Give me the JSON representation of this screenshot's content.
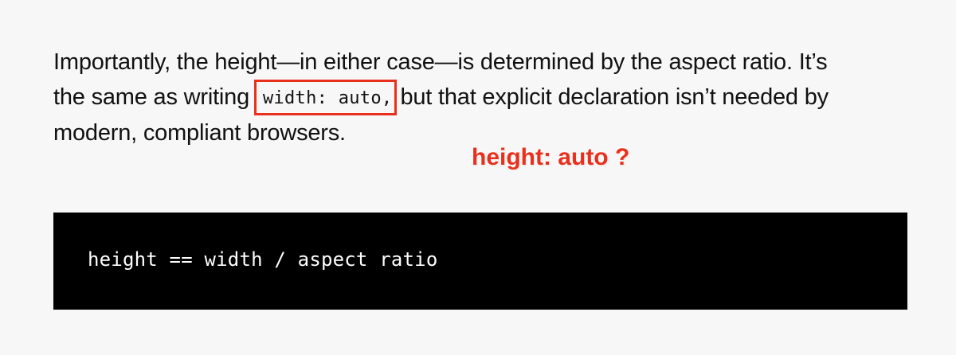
{
  "article": {
    "line1": "Importantly, the height—in either case—is determined by the aspect ratio. It’s",
    "line2_before": "the same as writing",
    "line2_code": "width: auto,",
    "line2_after": "but that explicit declaration isn’t needed by",
    "line3": "modern, compliant browsers."
  },
  "annotation": {
    "text": "height: auto ?",
    "color": "#e8301c"
  },
  "code_block": {
    "text": "height == width / aspect ratio",
    "background": "#000000"
  }
}
